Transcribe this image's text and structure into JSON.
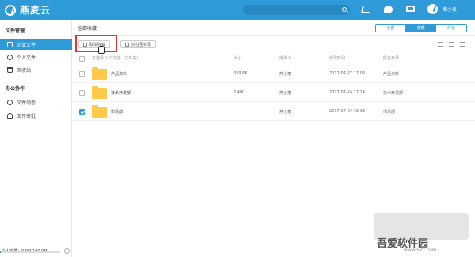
{
  "app": {
    "name": "燕麦云"
  },
  "topbar": {
    "search_placeholder": "",
    "username": "燕小麦"
  },
  "sidebar": {
    "section1": "文件管理",
    "items1": [
      {
        "label": "企业文件",
        "icon": "building-icon",
        "active": true
      },
      {
        "label": "个人文件",
        "icon": "person-icon",
        "active": false
      },
      {
        "label": "回收站",
        "icon": "trash-icon",
        "active": false
      }
    ],
    "section2": "办公协作",
    "items2": [
      {
        "label": "文件动态",
        "icon": "chat-icon"
      },
      {
        "label": "文件审批",
        "icon": "approval-icon"
      }
    ],
    "storage_label": "个人容量：0.9M/100.0M",
    "storage_fraction": 0.009
  },
  "main": {
    "breadcrumb": "全部收藏",
    "scope_tabs": [
      {
        "label": "全部",
        "active": false
      },
      {
        "label": "收藏",
        "active": true
      },
      {
        "label": "外链",
        "active": false
      }
    ],
    "toolbar": {
      "unfavorite_label": "取消收藏",
      "locate_label": "前往至目录"
    },
    "table": {
      "headers": {
        "selection": "已选择 1 个文件（文件夹）",
        "size": "大小",
        "modifier": "修改人",
        "modified_time": "修改时间",
        "location": "所在目录"
      },
      "rows": [
        {
          "name": "产品资料",
          "size": "339.6K",
          "modifier": "燕小麦",
          "time": "2017-07-27 17:02",
          "location": "产品资料",
          "checked": false
        },
        {
          "name": "技术开发部",
          "size": "2.4M",
          "modifier": "燕小麦",
          "time": "2017-07-24 17:14",
          "location": "技术开发部",
          "checked": false
        },
        {
          "name": "市场部",
          "size": "-",
          "modifier": "燕小麦",
          "time": "2017-07-24 16:38",
          "location": "市场部",
          "checked": true
        }
      ]
    }
  },
  "watermark": {
    "text": "吾爱软件园",
    "url": "www.52z.com"
  },
  "colors": {
    "brand": "#2e9ad8",
    "folder": "#ffc94a",
    "highlight": "#e53232"
  }
}
